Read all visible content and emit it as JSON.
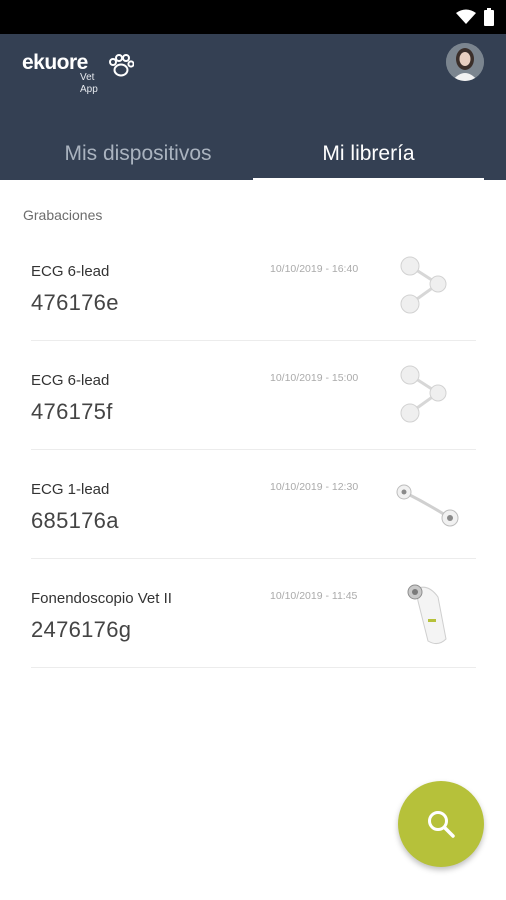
{
  "app": {
    "logo_text": "ekuore",
    "logo_subtitle": "Vet App"
  },
  "colors": {
    "header": "#344053",
    "fab": "#b6c13a"
  },
  "tabs": [
    {
      "label": "Mis dispositivos",
      "active": false
    },
    {
      "label": "Mi librería",
      "active": true
    }
  ],
  "section": {
    "label": "Grabaciones"
  },
  "recordings": [
    {
      "title": "ECG 6-lead",
      "id": "476176e",
      "date": "10/10/2019 - 16:40",
      "thumbnail": "ecg-6-lead-device"
    },
    {
      "title": "ECG 6-lead",
      "id": "476175f",
      "date": "10/10/2019 - 15:00",
      "thumbnail": "ecg-6-lead-device"
    },
    {
      "title": "ECG 1-lead",
      "id": "685176a",
      "date": "10/10/2019 - 12:30",
      "thumbnail": "ecg-1-lead-device"
    },
    {
      "title": "Fonendoscopio Vet II",
      "id": "2476176g",
      "date": "10/10/2019 - 11:45",
      "thumbnail": "stethoscope-device"
    }
  ],
  "fab": {
    "icon": "search-icon"
  },
  "status_icons": [
    "wifi-icon",
    "battery-icon"
  ]
}
